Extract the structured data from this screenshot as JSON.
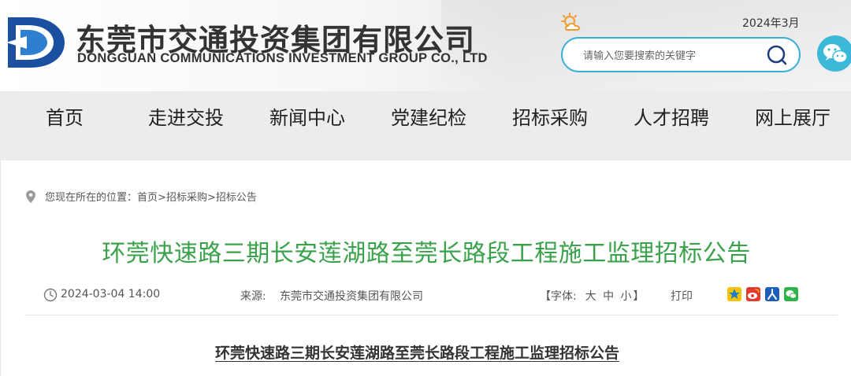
{
  "header": {
    "company_name_cn": "东莞市交通投资集团有限公司",
    "company_name_en": "DONGGUAN COMMUNICATIONS INVESTMENT GROUP CO., LTD",
    "date": "2024年3月",
    "search_placeholder": "请输入您要搜索的关键字",
    "logo_icon": "dg-logo-icon",
    "weather_icon": "sun-cloud-icon",
    "wechat_icon": "wechat-icon"
  },
  "nav": {
    "items": [
      {
        "label": "首页"
      },
      {
        "label": "走进交投"
      },
      {
        "label": "新闻中心"
      },
      {
        "label": "党建纪检"
      },
      {
        "label": "招标采购"
      },
      {
        "label": "人才招聘"
      },
      {
        "label": "网上展厅"
      }
    ]
  },
  "breadcrumb": {
    "prefix": "您现在所在的位置：",
    "items": [
      "首页",
      "招标采购",
      "招标公告"
    ],
    "separator": ">"
  },
  "article": {
    "title": "环莞快速路三期长安莲湖路至莞长路段工程施工监理招标公告",
    "date": "2024-03-04 14:00",
    "source_label": "来源:",
    "source": "东莞市交通投资集团有限公司",
    "font_label_open": "【字体:",
    "font_large": "大",
    "font_medium": "中",
    "font_small": "小",
    "font_label_close": "】",
    "print": "打印",
    "subtitle": "环莞快速路三期长安莲湖路至莞长路段工程施工监理招标公告"
  },
  "colors": {
    "accent_blue": "#3ab0d8",
    "title_green": "#3aa24a",
    "logo_blue": "#1b4fa0"
  }
}
